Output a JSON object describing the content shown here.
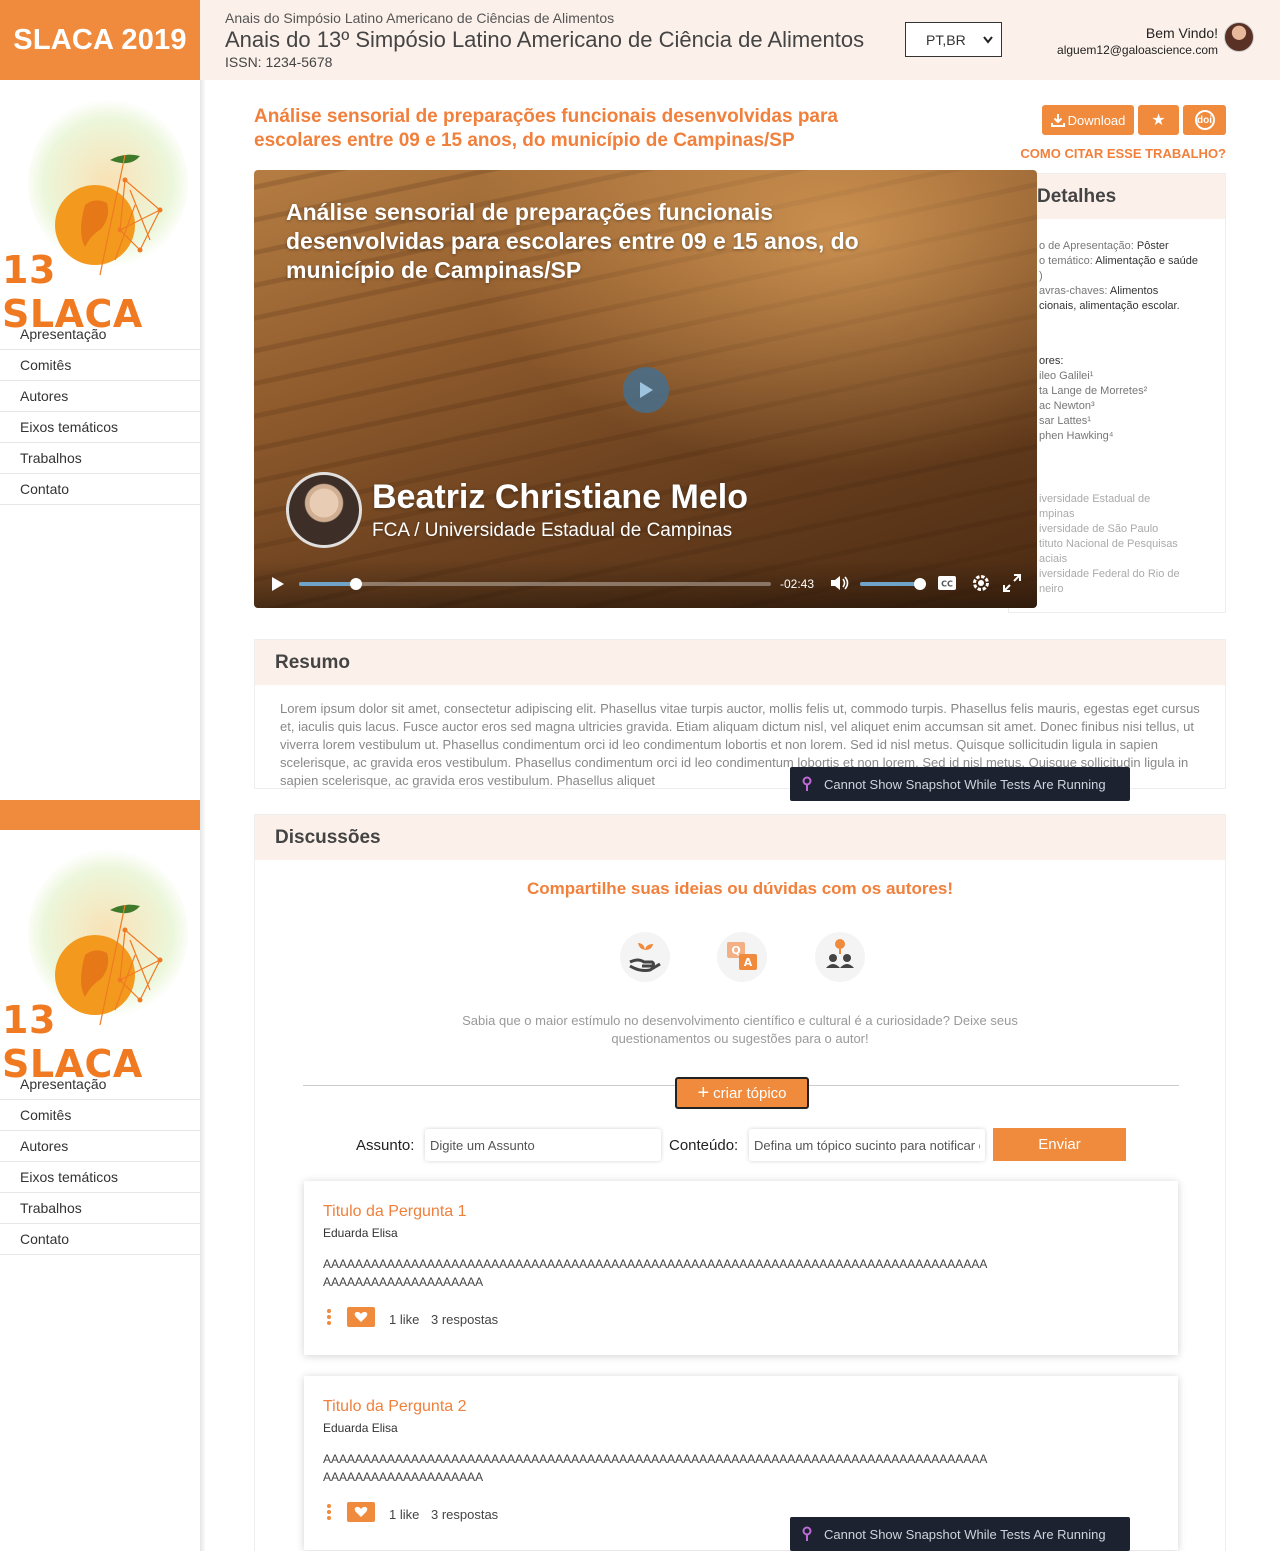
{
  "sidebar": {
    "brand": "SLACA 2019",
    "logo_text": "13 SLACA",
    "items": [
      {
        "label": "Apresentação"
      },
      {
        "label": "Comitês"
      },
      {
        "label": "Autores"
      },
      {
        "label": "Eixos temáticos"
      },
      {
        "label": "Trabalhos"
      },
      {
        "label": "Contato"
      }
    ]
  },
  "header": {
    "small_title": "Anais do Simpósio Latino Americano de Ciências de Alimentos",
    "title": "Anais do 13º Simpósio Latino Americano de Ciência de Alimentos",
    "issn": "ISSN: 1234-5678",
    "language": "PT,BR",
    "welcome": "Bem Vindo!",
    "email": "alguem12@galoascience.com"
  },
  "paper": {
    "title": "Análise sensorial de preparações funcionais desenvolvidas para escolares entre 09 e 15 anos, do município de Campinas/SP",
    "download_label": "Download",
    "doi_label": "doi",
    "cite_label": "COMO CITAR ESSE TRABALHO?"
  },
  "video": {
    "title": "Análise sensorial de preparações funcionais desenvolvidas para escolares entre 09 e 15 anos, do município de Campinas/SP",
    "presenter_name": "Beatriz Christiane Melo",
    "presenter_affiliation": "FCA / Universidade Estadual de Campinas",
    "time_remaining": "-02:43",
    "progress": 0.12,
    "volume": 1.0
  },
  "details": {
    "heading": "Detalhes",
    "rows": [
      {
        "key": "o de Apresentação: ",
        "value": "Pôster"
      },
      {
        "key": "o temático: ",
        "value": "Alimentação e saúde"
      },
      {
        "key": ")",
        "value": ""
      },
      {
        "key": "avras-chaves: ",
        "value": "Alimentos"
      },
      {
        "key": "",
        "value": "cionais, alimentação escolar."
      }
    ],
    "authors_label": "ores:",
    "authors": [
      "ileo Galilei¹",
      "ta Lange de Morretes²",
      "ac Newton³",
      "sar Lattes¹",
      "phen Hawking⁴"
    ],
    "affiliations": [
      "iversidade Estadual de",
      "mpinas",
      "iversidade de São Paulo",
      "tituto Nacional de Pesquisas",
      "aciais",
      "iversidade Federal do Rio de",
      "neiro"
    ]
  },
  "resumo": {
    "heading": "Resumo",
    "text": "Lorem ipsum dolor sit amet, consectetur adipiscing elit. Phasellus vitae turpis auctor, mollis felis ut, commodo turpis. Phasellus felis mauris, egestas eget cursus et, iaculis quis lacus. Fusce auctor eros sed magna ultricies gravida. Etiam aliquam dictum nisl, vel aliquet enim accumsan sit amet. Donec finibus nisi tellus, ut viverra lorem vestibulum ut. Phasellus condimentum orci id leo condimentum lobortis et non lorem. Sed id nisl metus. Quisque sollicitudin ligula in sapien scelerisque, ac gravida eros vestibulum. Phasellus condimentum orci id leo condimentum lobortis et non lorem. Sed id nisl metus. Quisque sollicitudin ligula in sapien scelerisque, ac gravida eros vestibulum. Phasellus aliquet"
  },
  "discussoes": {
    "heading": "Discussões",
    "cta": "Compartilhe suas ideias ou dúvidas com os autores!",
    "sub": "Sabia que o maior estímulo no desenvolvimento científico e cultural é a curiosidade? Deixe seus questionamentos ou sugestões para o autor!",
    "create_topic": "criar tópico",
    "assunto_label": "Assunto:",
    "assunto_placeholder": "Digite um Assunto",
    "conteudo_label": "Conteúdo:",
    "conteudo_placeholder": "Defina um tópico sucinto para notificar os autores...",
    "send_label": "Enviar",
    "questions": [
      {
        "title": "Titulo da Pergunta 1",
        "author": "Eduarda Elisa",
        "body": "AAAAAAAAAAAAAAAAAAAAAAAAAAAAAAAAAAAAAAAAAAAAAAAAAAAAAAAAAAAAAAAAAAAAAAAAAAAAAAAAAAAAAAAAAAAAAAAAAAAAAAA",
        "likes": "1 like",
        "replies": "3 respostas"
      },
      {
        "title": "Titulo da Pergunta 2",
        "author": "Eduarda Elisa",
        "body": "AAAAAAAAAAAAAAAAAAAAAAAAAAAAAAAAAAAAAAAAAAAAAAAAAAAAAAAAAAAAAAAAAAAAAAAAAAAAAAAAAAAAAAAAAAAAAAAAAAAAAAA",
        "likes": "1 like",
        "replies": "3 respostas"
      }
    ]
  },
  "overlay": {
    "message": "Cannot Show Snapshot While Tests Are Running"
  },
  "colors": {
    "accent": "#f08a3c",
    "header_bg": "#fcf1ea",
    "toast_bg": "#1c2230"
  }
}
